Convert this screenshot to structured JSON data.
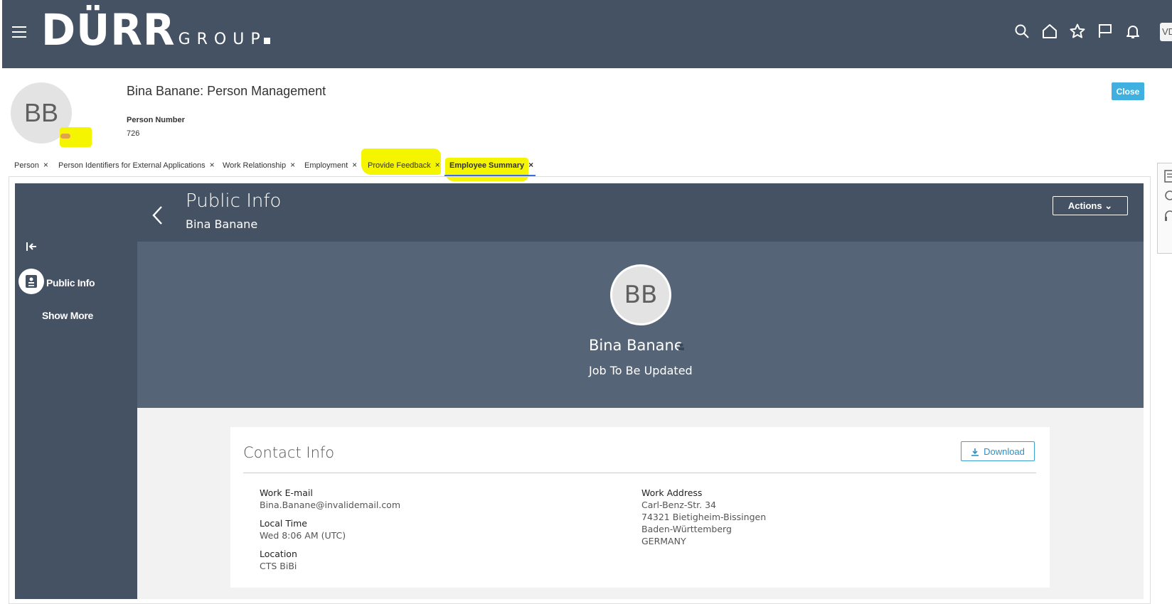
{
  "brand": {
    "name": "DÜRR",
    "sub": "GROUP"
  },
  "header_icons": [
    "search-icon",
    "home-icon",
    "star-icon",
    "flag-icon",
    "bell-icon"
  ],
  "user_badge": "VD",
  "person": {
    "initials": "BB",
    "title": "Bina Banane: Person Management",
    "number_label": "Person Number",
    "number": "726"
  },
  "close_label": "Close",
  "tabs": [
    {
      "label": "Person"
    },
    {
      "label": "Person Identifiers for External Applications"
    },
    {
      "label": "Work Relationship"
    },
    {
      "label": "Employment"
    },
    {
      "label": "Provide Feedback"
    },
    {
      "label": "Employee Summary"
    }
  ],
  "tab_close": "×",
  "panel": {
    "title": "Public Info",
    "subtitle": "Bina Banane",
    "actions_label": "Actions",
    "nav": {
      "public_info": "Public Info",
      "show_more": "Show More"
    }
  },
  "hero": {
    "initials": "BB",
    "name": "Bina Banane",
    "job": "Job To Be Updated"
  },
  "contact": {
    "title": "Contact Info",
    "download_label": "Download",
    "work_email_label": "Work E-mail",
    "work_email": "Bina.Banane@invalidemail.com",
    "local_time_label": "Local Time",
    "local_time": "Wed 8:06 AM (UTC)",
    "location_label": "Location",
    "location": "CTS BiBi",
    "work_address_label": "Work Address",
    "address_lines": [
      "Carl-Benz-Str. 34",
      "74321 Bietigheim-Bissingen",
      "Baden-Württemberg",
      "GERMANY"
    ]
  },
  "colors": {
    "topbar": "#445264",
    "hero": "#556476",
    "accent": "#3fb0e0",
    "highlight": "#f5f500"
  }
}
